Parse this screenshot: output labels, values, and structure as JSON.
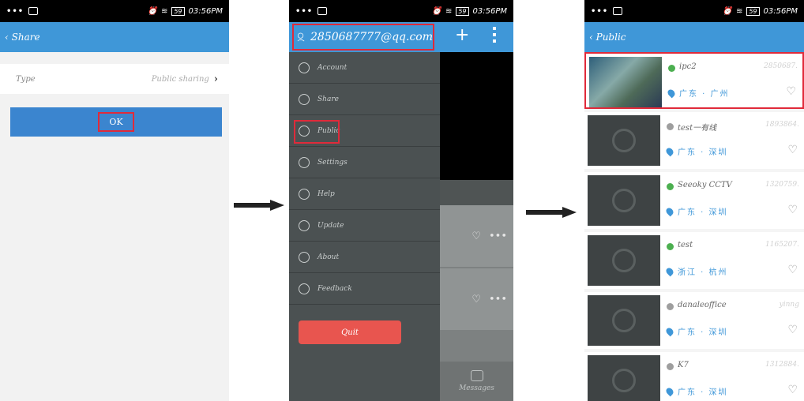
{
  "status": {
    "time": "03:56PM",
    "battery": "59"
  },
  "screen1": {
    "back_label": "Share",
    "type_label": "Type",
    "type_value": "Public sharing",
    "ok_label": "OK"
  },
  "screen2": {
    "account": "2850687777@qq.com",
    "menu": [
      {
        "label": "Account",
        "icon": "account-icon"
      },
      {
        "label": "Share",
        "icon": "share-icon"
      },
      {
        "label": "Public",
        "icon": "globe-icon"
      },
      {
        "label": "Settings",
        "icon": "gear-icon"
      },
      {
        "label": "Help",
        "icon": "help-icon"
      },
      {
        "label": "Update",
        "icon": "update-icon"
      },
      {
        "label": "About",
        "icon": "info-icon"
      },
      {
        "label": "Feedback",
        "icon": "feedback-icon"
      }
    ],
    "quit_label": "Quit",
    "messages_label": "Messages"
  },
  "screen3": {
    "back_label": "Public",
    "cameras": [
      {
        "name": "ipc2",
        "id": "2850687.",
        "location": "广东 · 广州",
        "online": true
      },
      {
        "name": "test一有线",
        "id": "1893864.",
        "location": "广东 · 深圳",
        "online": false
      },
      {
        "name": "Seeoky CCTV",
        "id": "1320759.",
        "location": "广东 · 深圳",
        "online": true
      },
      {
        "name": "test",
        "id": "1165207.",
        "location": "浙江 · 杭州",
        "online": true
      },
      {
        "name": "danaleoffice",
        "id": "yinng",
        "location": "广东 · 深圳",
        "online": false
      },
      {
        "name": "K7",
        "id": "1312884.",
        "location": "广东 · 深圳",
        "online": false
      }
    ]
  },
  "colors": {
    "accent": "#3f97d8",
    "highlight": "#e02a3a",
    "online": "#4caf50",
    "offline": "#9e9e9e",
    "quit": "#e8554f"
  }
}
